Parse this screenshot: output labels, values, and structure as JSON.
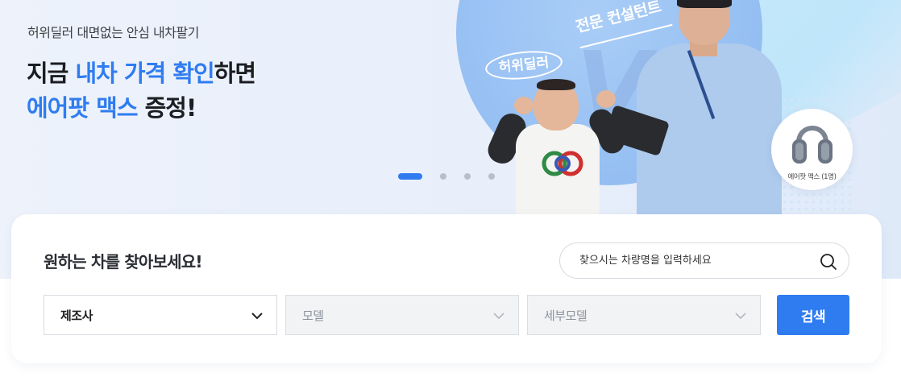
{
  "hero": {
    "sub_copy": "허위딜러 대면없는 안심 내차팔기",
    "headline_line1_pre": "지금 ",
    "headline_line1_highlight": "내차 가격 확인",
    "headline_line1_post": "하면",
    "headline_line2_highlight": "에어팟 맥스",
    "headline_line2_post": " 증정!",
    "tag_worker": "허위딜러",
    "tag_pro": "전문 컨설턴트",
    "vs": "VS",
    "airpods_caption": "에어팟 맥스 (1명)",
    "carousel": {
      "total": 4,
      "active_index": 0
    }
  },
  "search_card": {
    "title": "원하는 차를 찾아보세요!",
    "search_placeholder": "찾으시는 차량명을 입력하세요",
    "selects": [
      {
        "label": "제조사",
        "enabled": true
      },
      {
        "label": "모델",
        "enabled": false
      },
      {
        "label": "세부모델",
        "enabled": false
      }
    ],
    "search_button": "검색"
  },
  "colors": {
    "accent": "#2f7cf0",
    "hero_bg": "#e8effb",
    "text_dark": "#1b1d22"
  }
}
